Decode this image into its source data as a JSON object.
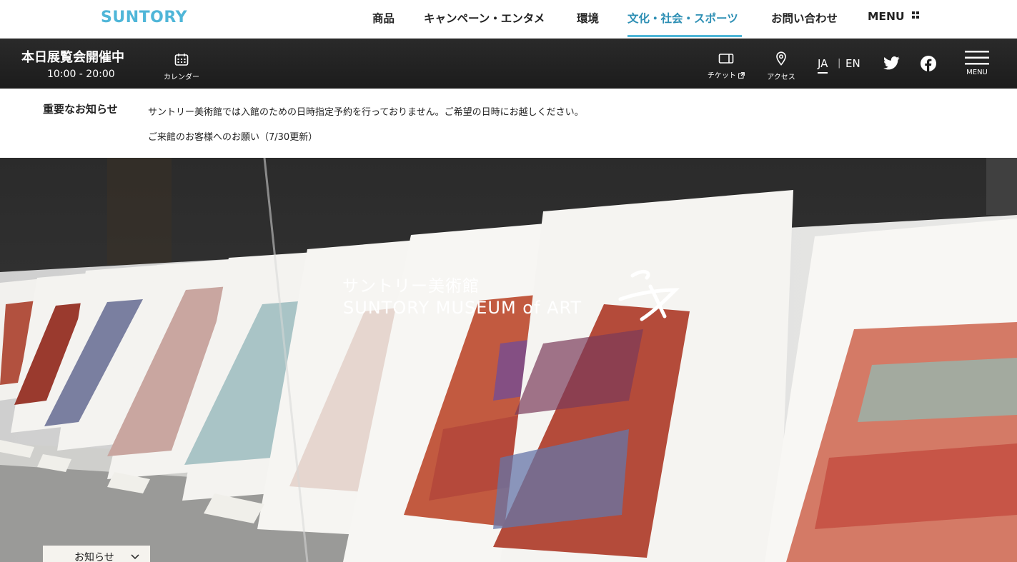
{
  "header": {
    "logo": "SUNTORY",
    "nav": [
      {
        "label": "商品"
      },
      {
        "label": "キャンペーン・エンタメ"
      },
      {
        "label": "環境"
      },
      {
        "label": "文化・社会・スポーツ"
      },
      {
        "label": "お問い合わせ"
      },
      {
        "label": "MENU"
      }
    ],
    "active_index": 3,
    "accent_color": "#4fb6d8"
  },
  "infobar": {
    "open_status": "本日展覧会開催中",
    "hours": "10:00 - 20:00",
    "calendar_label": "カレンダー",
    "ticket_label": "チケット",
    "access_label": "アクセス",
    "lang_ja": "JA",
    "lang_sep": "|",
    "lang_en": "EN",
    "menu_label": "MENU"
  },
  "notice": {
    "label": "重要なお知らせ",
    "lines": [
      "サントリー美術館では入館のための日時指定予約を行っておりません。ご希望の日時にお越しください。",
      "ご来館のお客様へのお願い（7/30更新）"
    ]
  },
  "hero": {
    "title_jp": "サントリー美術館",
    "title_en": "SUNTORY MUSEUM of ART"
  },
  "news_tab": {
    "label": "お知らせ"
  }
}
